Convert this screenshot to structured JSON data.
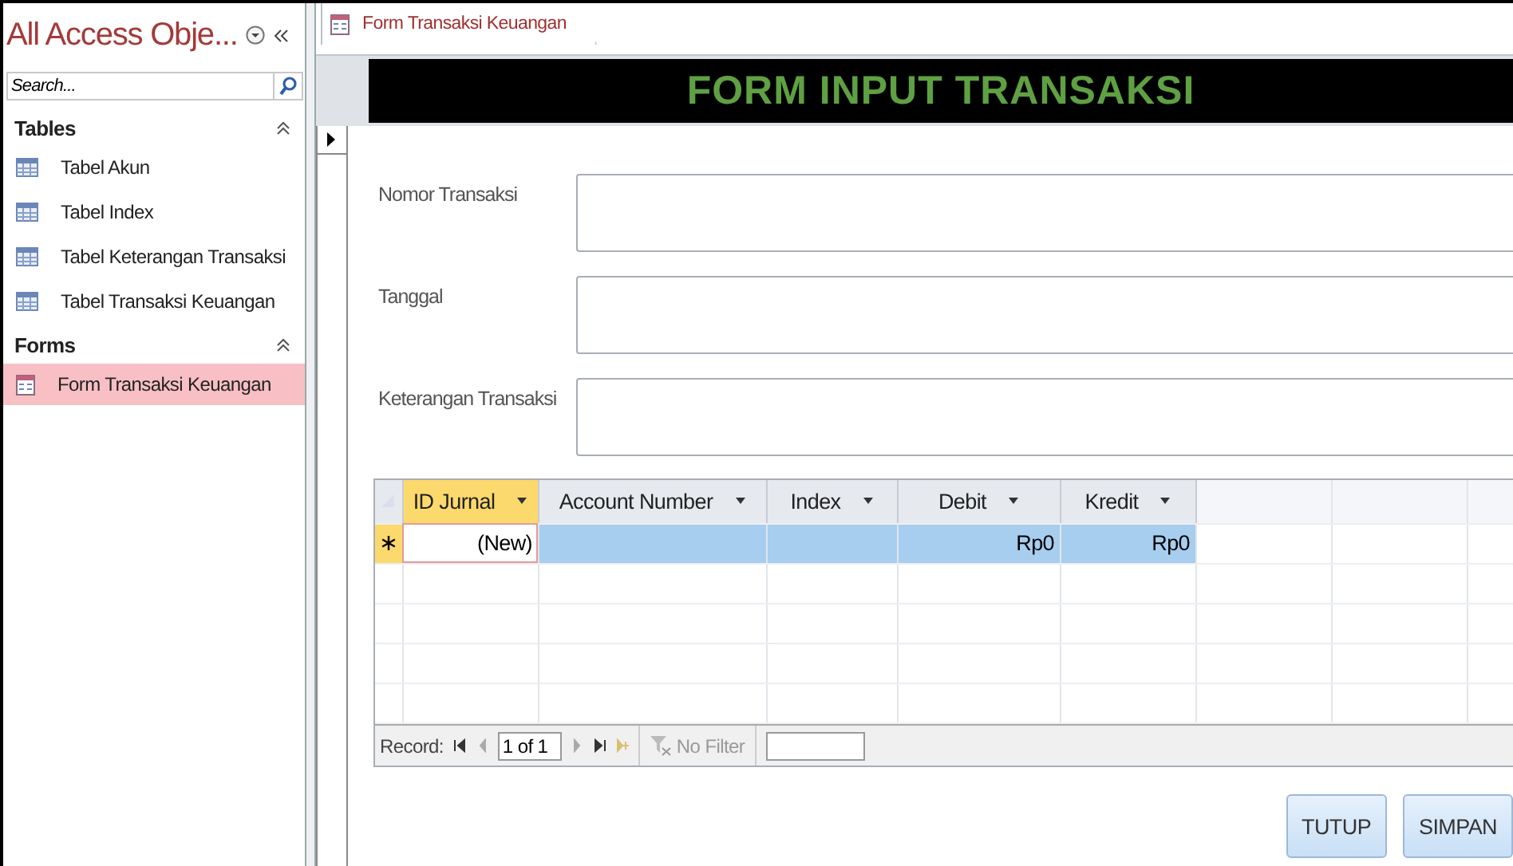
{
  "nav_pane": {
    "title": "All Access Obje...",
    "search": {
      "placeholder": "Search..."
    },
    "groups": [
      {
        "label": "Tables",
        "expanded": true,
        "items": [
          {
            "label": "Tabel Akun",
            "kind": "table",
            "selected": false
          },
          {
            "label": "Tabel Index",
            "kind": "table",
            "selected": false
          },
          {
            "label": "Tabel Keterangan Transaksi",
            "kind": "table",
            "selected": false
          },
          {
            "label": "Tabel Transaksi Keuangan",
            "kind": "table",
            "selected": false
          }
        ]
      },
      {
        "label": "Forms",
        "expanded": true,
        "items": [
          {
            "label": "Form Transaksi Keuangan",
            "kind": "form",
            "selected": true
          }
        ]
      }
    ]
  },
  "tabs": [
    {
      "label": "Form Transaksi Keuangan",
      "selected": true
    }
  ],
  "form": {
    "header": "FORM INPUT TRANSAKSI",
    "fields": [
      {
        "label": "Nomor Transaksi"
      },
      {
        "label": "Tanggal"
      },
      {
        "label": "Keterangan Transaksi"
      }
    ],
    "datasheet": {
      "columns": [
        {
          "label": "ID Jurnal",
          "selected": true
        },
        {
          "label": "Account Number",
          "selected": false
        },
        {
          "label": "Index",
          "selected": false
        },
        {
          "label": "Debit",
          "selected": false
        },
        {
          "label": "Kredit",
          "selected": false
        }
      ],
      "rows": [
        {
          "new": true,
          "selected": true,
          "cells": [
            {
              "text": "(New)",
              "focused": true
            },
            {
              "text": "",
              "focused": false
            },
            {
              "text": "",
              "focused": false
            },
            {
              "text": "Rp0",
              "focused": false
            },
            {
              "text": "Rp0",
              "focused": false
            }
          ]
        }
      ],
      "navigation": {
        "label": "Record:",
        "position": "1 of 1",
        "filter": "No Filter",
        "filter_disabled": true
      }
    },
    "buttons": [
      {
        "label": "TUTUP"
      },
      {
        "label": "SIMPAN"
      }
    ]
  }
}
